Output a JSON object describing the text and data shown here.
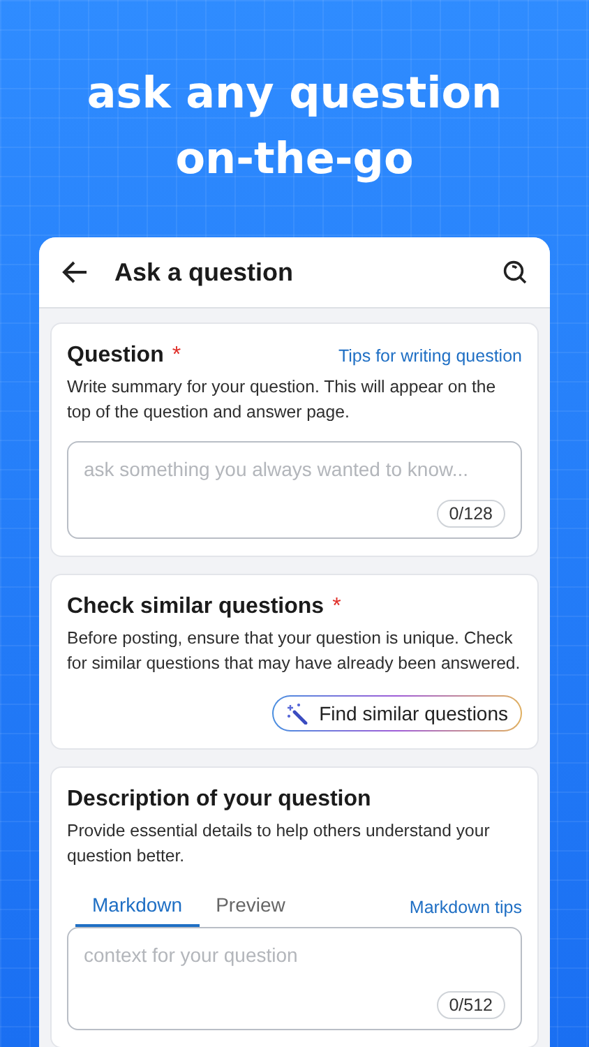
{
  "headline": [
    "ask any question",
    "on-the-go"
  ],
  "app_bar": {
    "title": "Ask a question"
  },
  "sections": [
    {
      "kind": "question",
      "title": "Question",
      "required_mark": "*",
      "link": "Tips for writing question",
      "description": "Write summary for your question. This will appear on the top of the question and answer page.",
      "placeholder": "ask something you always wanted to know...",
      "counter": "0/128"
    },
    {
      "kind": "similar",
      "title": "Check similar questions",
      "required_mark": "*",
      "description": "Before posting, ensure that your question is unique. Check for similar questions that may have already been answered.",
      "button": "Find similar questions"
    },
    {
      "kind": "description",
      "title": "Description of your question",
      "description": "Provide essential details to help others understand your question better.",
      "tabs": [
        {
          "label": "Markdown",
          "selected": true
        },
        {
          "label": "Preview",
          "selected": false
        }
      ],
      "link": "Markdown tips",
      "placeholder": "context for your question",
      "counter": "0/512"
    }
  ]
}
